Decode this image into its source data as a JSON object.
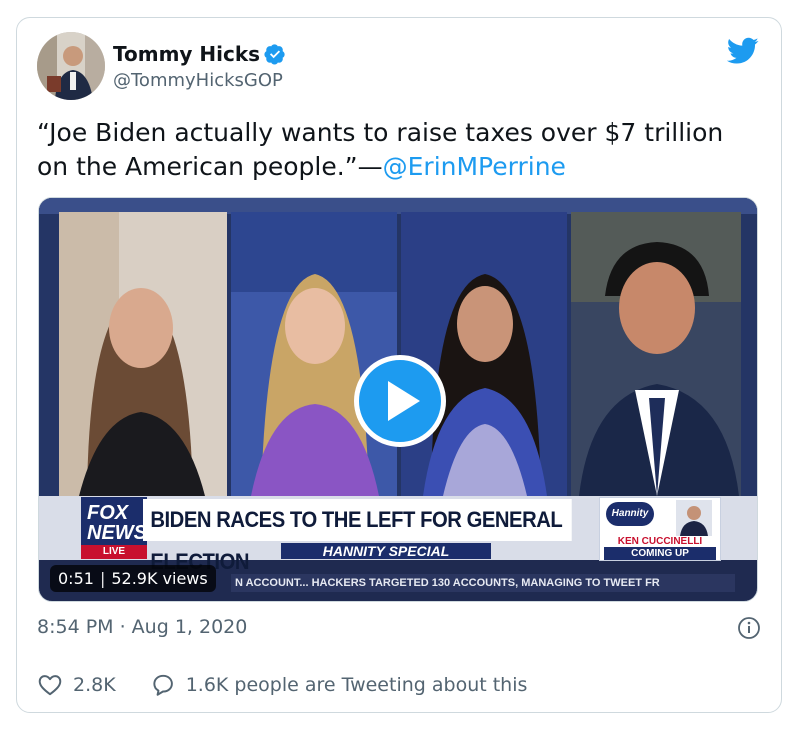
{
  "author": {
    "display_name": "Tommy Hicks",
    "handle": "@TommyHicksGOP",
    "verified": true
  },
  "tweet": {
    "text_before": "“Joe Biden actually wants to raise taxes over $7 trillion on the American people.”—",
    "mention": "@ErinMPerrine"
  },
  "video": {
    "duration": "0:51",
    "views": "52.9K views",
    "chyron": {
      "network_logo_top": "FOX",
      "network_logo_bottom": "NEWS",
      "network_live": "LIVE",
      "headline": "BIDEN RACES TO THE LEFT FOR GENERAL ELECTION",
      "show": "HANNITY SPECIAL",
      "promo_badge": "Hannity",
      "promo_name": "KEN CUCCINELLI",
      "promo_cta": "COMING UP",
      "ticker": "N ACCOUNT...   HACKERS TARGETED 130 ACCOUNTS, MANAGING TO TWEET FR"
    }
  },
  "meta": {
    "timestamp": "8:54 PM · Aug 1, 2020"
  },
  "actions": {
    "likes": "2.8K",
    "conversation": "1.6K people are Tweeting about this"
  },
  "colors": {
    "accent": "#1d9bf0",
    "text": "#0f1419",
    "muted": "#536471",
    "border": "#cfd9de"
  }
}
